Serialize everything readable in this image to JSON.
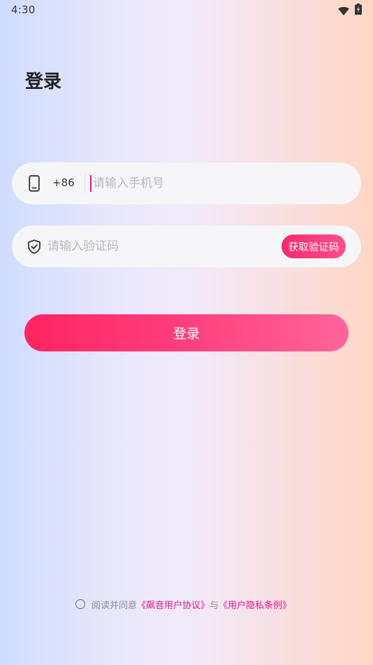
{
  "status_bar": {
    "time": "4:30",
    "wifi_icon": "wifi-icon",
    "battery_icon": "battery-charging-icon"
  },
  "title": "登录",
  "phone_field": {
    "icon": "phone-icon",
    "country_code": "+86",
    "placeholder": "请输入手机号",
    "value": ""
  },
  "code_field": {
    "icon": "shield-check-icon",
    "placeholder": "请输入验证码",
    "value": "",
    "get_code_label": "获取验证码"
  },
  "login_button_label": "登录",
  "agreement": {
    "prefix": "阅读并同意",
    "user_agreement": "《飙音用户协议》",
    "connector": "与",
    "privacy_policy": "《用户隐私条例》",
    "checked": false
  },
  "colors": {
    "accent": "#ff2d6e",
    "link": "#e2168a",
    "input_background": "#f6f5f8"
  }
}
